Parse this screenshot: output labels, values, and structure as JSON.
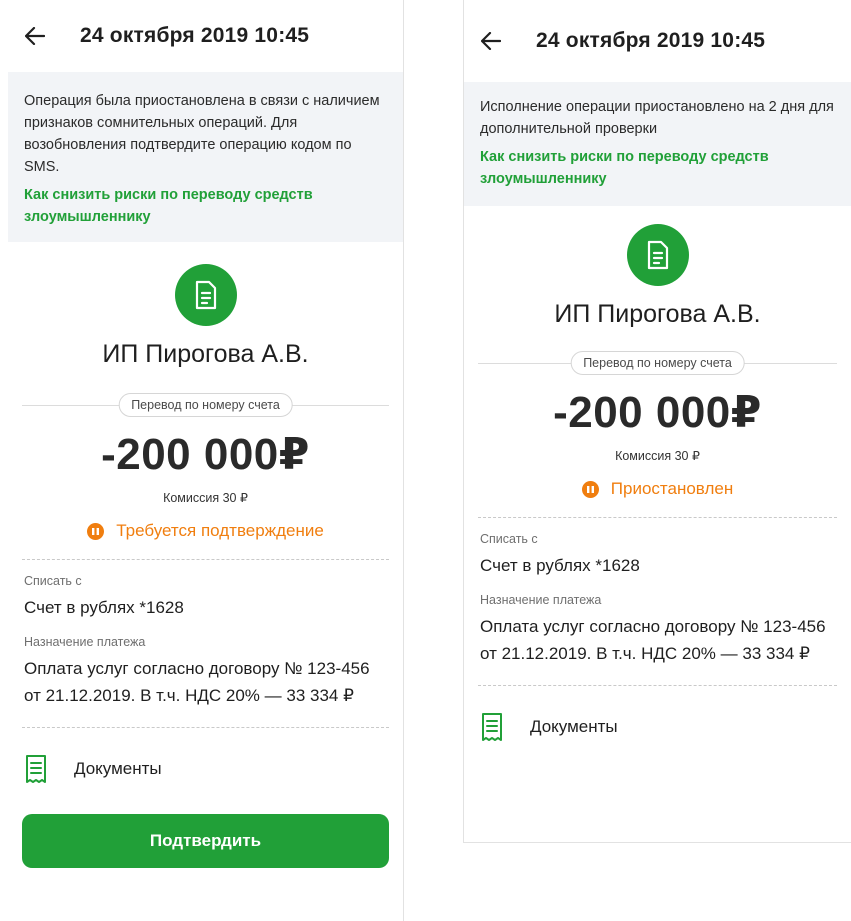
{
  "colors": {
    "accent_green": "#21a038",
    "status_orange": "#f07e0f",
    "notice_bg": "#f2f4f7"
  },
  "screens": [
    {
      "header": {
        "back_icon": "arrow-left-icon",
        "title": "24 октября 2019 10:45"
      },
      "notice": {
        "text": "Операция была приостановлена в связи с наличием признаков сомнительных операций. Для возобновления подтвердите операцию кодом по SMS.",
        "link": "Как снизить риски по переводу средств злоумышленнику"
      },
      "payee": "ИП Пирогова А.В.",
      "transfer_type": "Перевод по номеру счета",
      "amount": "-200 000₽",
      "commission": "Комиссия 30 ₽",
      "status": {
        "icon": "pause-icon",
        "text": "Требуется подтверждение"
      },
      "debit": {
        "label": "Списать с",
        "value": "Счет в рублях *1628"
      },
      "purpose": {
        "label": "Назначение платежа",
        "value": "Оплата услуг согласно договору № 123-456 от 21.12.2019. В т.ч. НДС 20% — 33 334 ₽"
      },
      "documents": {
        "icon": "receipt-icon",
        "label": "Документы"
      },
      "confirm_button": "Подтвердить"
    },
    {
      "header": {
        "back_icon": "arrow-left-icon",
        "title": "24 октября 2019 10:45"
      },
      "notice": {
        "text": "Исполнение операции приостановлено на 2 дня для дополнительной проверки",
        "link": "Как снизить риски по переводу средств злоумышленнику"
      },
      "payee": "ИП Пирогова А.В.",
      "transfer_type": "Перевод по номеру счета",
      "amount": "-200 000₽",
      "commission": "Комиссия 30 ₽",
      "status": {
        "icon": "pause-icon",
        "text": "Приостановлен"
      },
      "debit": {
        "label": "Списать с",
        "value": "Счет в рублях *1628"
      },
      "purpose": {
        "label": "Назначение платежа",
        "value": "Оплата услуг согласно договору № 123-456 от 21.12.2019. В т.ч. НДС 20% — 33 334 ₽"
      },
      "documents": {
        "icon": "receipt-icon",
        "label": "Документы"
      }
    }
  ]
}
